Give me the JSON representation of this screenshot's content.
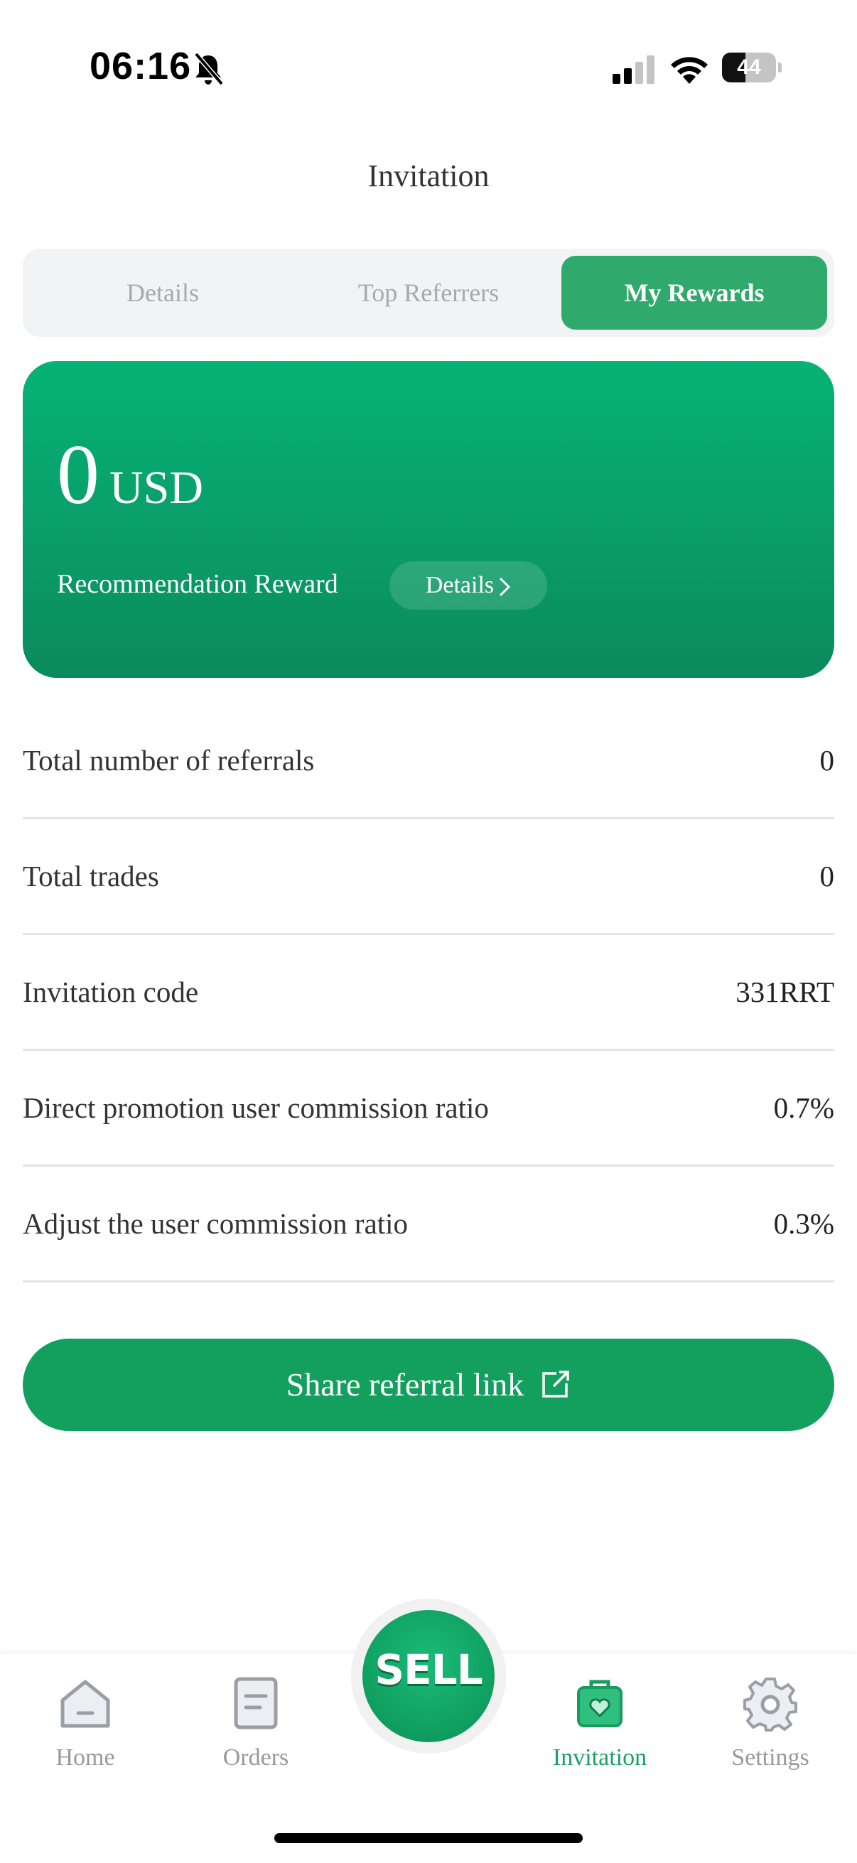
{
  "status_bar": {
    "time": "06:16",
    "battery_text": "44",
    "battery_level": 0.44,
    "icons": [
      "bell-slash-icon",
      "cellular-signal-icon",
      "wifi-icon",
      "battery-icon"
    ]
  },
  "header": {
    "title": "Invitation"
  },
  "tabs": [
    {
      "label": "Details",
      "active": false
    },
    {
      "label": "Top Referrers",
      "active": false
    },
    {
      "label": "My Rewards",
      "active": true
    }
  ],
  "reward_card": {
    "amount": "0",
    "currency": "USD",
    "label": "Recommendation Reward",
    "details_label": "Details",
    "gradient": [
      "#05b377",
      "#0b8a5e"
    ]
  },
  "info_rows": [
    {
      "label": "Total number of referrals",
      "value": "0"
    },
    {
      "label": "Total trades",
      "value": "0"
    },
    {
      "label": "Invitation code",
      "value": "331RRT"
    },
    {
      "label": "Direct promotion user commission ratio",
      "value": "0.7%"
    },
    {
      "label": "Adjust the user commission ratio",
      "value": "0.3%"
    }
  ],
  "share_button": {
    "label": "Share referral link",
    "icon": "external-link-icon"
  },
  "bottom_nav": {
    "items": [
      {
        "label": "Home",
        "icon": "home-icon",
        "active": false
      },
      {
        "label": "Orders",
        "icon": "orders-icon",
        "active": false
      },
      {
        "label": "Invitation",
        "icon": "invitation-icon",
        "active": true
      },
      {
        "label": "Settings",
        "icon": "gear-icon",
        "active": false
      }
    ],
    "sell_label": "SELL"
  },
  "colors": {
    "accent": "#13a05f",
    "active_tab": "#2faa6c",
    "inactive_text": "#999999",
    "divider": "#e4e4e4"
  }
}
